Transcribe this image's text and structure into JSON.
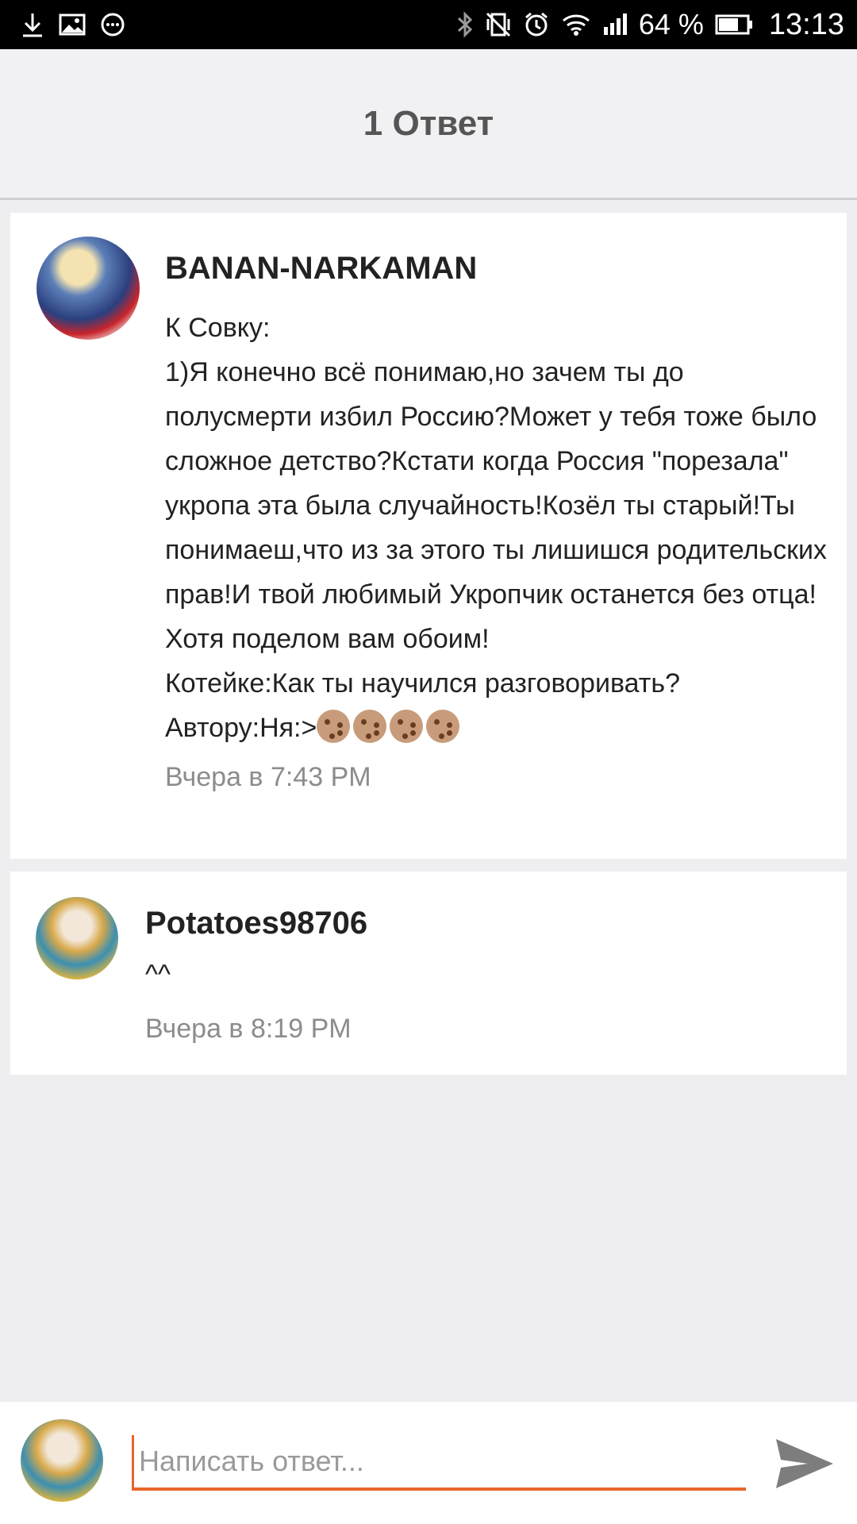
{
  "status_bar": {
    "battery_percent": "64 %",
    "time": "13:13",
    "left_icons": [
      "download-icon",
      "image-icon",
      "chat-bubble-icon"
    ],
    "right_icons": [
      "bluetooth-icon",
      "vibrate-off-icon",
      "alarm-icon",
      "wifi-icon",
      "signal-icon",
      "battery-icon"
    ]
  },
  "header": {
    "title": "1 Ответ"
  },
  "comments": [
    {
      "username": "BANAN-NARKAMAN",
      "text": "К Совку:\n1)Я конечно всё понимаю,но зачем ты до полусмерти избил Россию?Может у тебя тоже было сложное детство?Кстати когда Россия \"порезала\" укропа эта была случайность!Козёл ты старый!Ты понимаеш,что из за этого ты лишишся родительских прав!И твой любимый Укропчик останется без отца!Хотя поделом вам обоим!\nКотейке:Как ты научился разговоривать?\nАвтору:Ня:>",
      "emoji_count": 4,
      "emoji": "cookie-icon",
      "timestamp": "Вчера в 7:43 PM"
    },
    {
      "username": "Potatoes98706",
      "text": "^^",
      "timestamp": "Вчера в 8:19 PM"
    }
  ],
  "reply": {
    "placeholder": "Написать ответ...",
    "send_icon": "send-icon"
  },
  "colors": {
    "accent": "#e8652b",
    "background": "#eeeef1",
    "card": "#ffffff",
    "timestamp": "#8c8c8c"
  }
}
